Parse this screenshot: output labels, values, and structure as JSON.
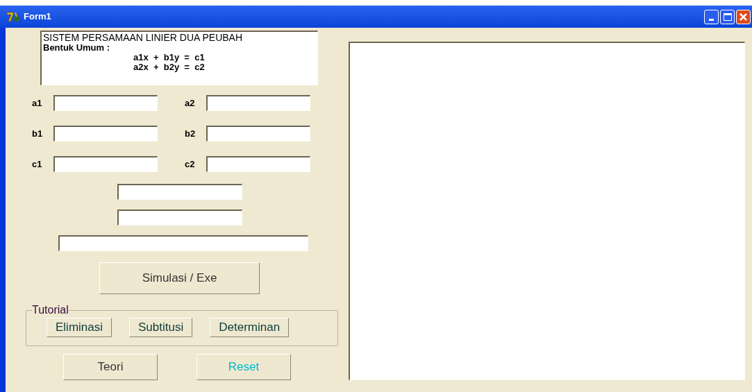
{
  "window": {
    "title": "Form1"
  },
  "info": {
    "title": "SISTEM PERSAMAAN LINIER DUA PEUBAH",
    "subtitle": "Bentuk Umum :",
    "equations": [
      "a1x  +  b1y  =  c1",
      "a2x  +  b2y  =  c2"
    ]
  },
  "coefficient_rows": [
    [
      {
        "label": "a1"
      },
      {
        "label": "a2"
      }
    ],
    [
      {
        "label": "b1"
      },
      {
        "label": "b2"
      }
    ],
    [
      {
        "label": "c1"
      },
      {
        "label": "c2"
      }
    ]
  ],
  "execute_button": "Simulasi / Exe",
  "tutorial": {
    "legend": "Tutorial",
    "buttons": [
      "Eliminasi",
      "Subtitusi",
      "Determinan"
    ]
  },
  "bottom_buttons": [
    {
      "label": "Teori",
      "color": "#333333"
    },
    {
      "label": "Reset",
      "color": "#00b8cc"
    }
  ]
}
